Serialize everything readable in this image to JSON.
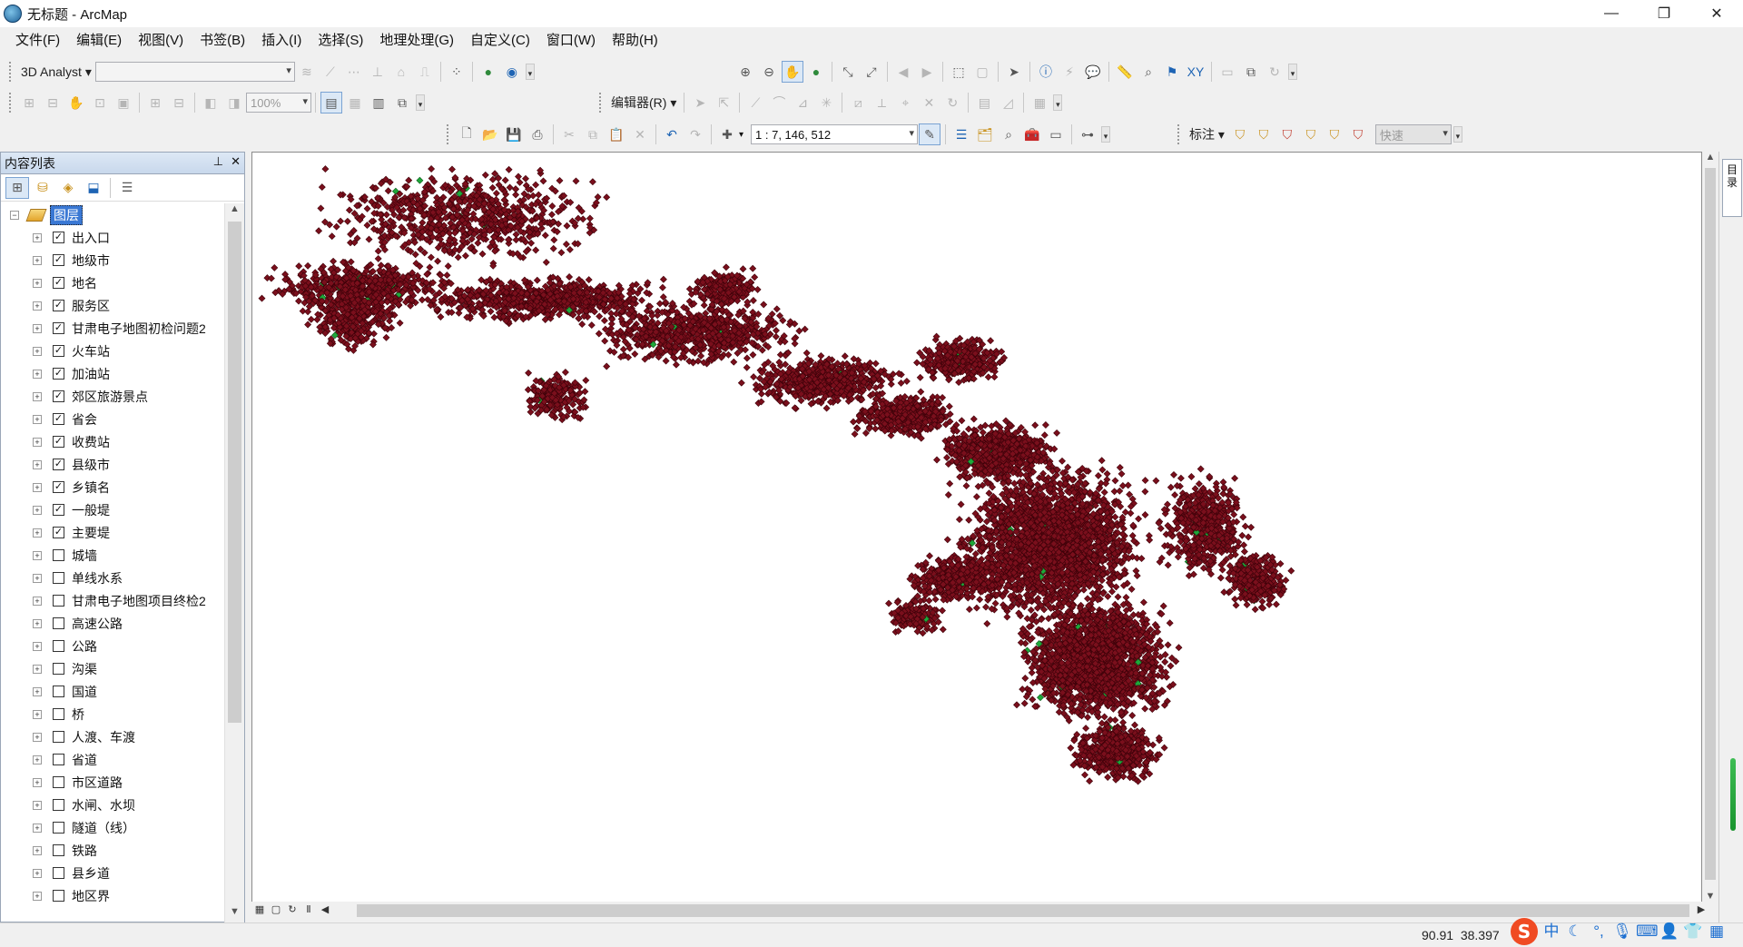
{
  "window": {
    "title": "无标题 - ArcMap",
    "minimize": "—",
    "maximize": "❐",
    "close": "✕"
  },
  "menubar": [
    "文件(F)",
    "编辑(E)",
    "视图(V)",
    "书签(B)",
    "插入(I)",
    "选择(S)",
    "地理处理(G)",
    "自定义(C)",
    "窗口(W)",
    "帮助(H)"
  ],
  "toolbars": {
    "analyst_3d": {
      "label": "3D Analyst ▾",
      "layer_value": ""
    },
    "georef": {
      "zoom_percent": "100%"
    },
    "editor": {
      "label": "编辑器(R) ▾"
    },
    "standard": {
      "scale_value": "1 : 7, 146, 512"
    },
    "labeling": {
      "label": "标注 ▾",
      "mode_value": "快速"
    }
  },
  "toc": {
    "title": "内容列表",
    "pin": "📌",
    "close": "✕",
    "root": "图层",
    "layers": [
      {
        "name": "出入口",
        "checked": true
      },
      {
        "name": "地级市",
        "checked": true
      },
      {
        "name": "地名",
        "checked": true
      },
      {
        "name": "服务区",
        "checked": true
      },
      {
        "name": "甘肃电子地图初检问题2",
        "checked": true
      },
      {
        "name": "火车站",
        "checked": true
      },
      {
        "name": "加油站",
        "checked": true
      },
      {
        "name": "郊区旅游景点",
        "checked": true
      },
      {
        "name": "省会",
        "checked": true
      },
      {
        "name": "收费站",
        "checked": true
      },
      {
        "name": "县级市",
        "checked": true
      },
      {
        "name": "乡镇名",
        "checked": true
      },
      {
        "name": "一般堤",
        "checked": true
      },
      {
        "name": "主要堤",
        "checked": true
      },
      {
        "name": "城墙",
        "checked": false
      },
      {
        "name": "单线水系",
        "checked": false
      },
      {
        "name": "甘肃电子地图项目终检2",
        "checked": false
      },
      {
        "name": "高速公路",
        "checked": false
      },
      {
        "name": "公路",
        "checked": false
      },
      {
        "name": "沟渠",
        "checked": false
      },
      {
        "name": "国道",
        "checked": false
      },
      {
        "name": "桥",
        "checked": false
      },
      {
        "name": "人渡、车渡",
        "checked": false
      },
      {
        "name": "省道",
        "checked": false
      },
      {
        "name": "市区道路",
        "checked": false
      },
      {
        "name": "水闸、水坝",
        "checked": false
      },
      {
        "name": "隧道（线）",
        "checked": false
      },
      {
        "name": "铁路",
        "checked": false
      },
      {
        "name": "县乡道",
        "checked": false
      },
      {
        "name": "地区界",
        "checked": false
      }
    ]
  },
  "right_dock": {
    "catalog_label": "目录"
  },
  "status": {
    "x": "90.91",
    "y": "38.397"
  },
  "ime": {
    "logo": "S",
    "lang": "中"
  },
  "colors": {
    "point_fill": "#7a0f1c",
    "point_edge": "#3d0209",
    "highlight_point": "#1fa83a",
    "selection": "#3a78d4"
  },
  "icons": {
    "zoom_in": "zoom-in-icon",
    "zoom_out": "zoom-out-icon",
    "pan": "pan-hand-icon",
    "full_extent": "globe-icon",
    "identify": "info-icon",
    "find": "binoculars-icon"
  }
}
